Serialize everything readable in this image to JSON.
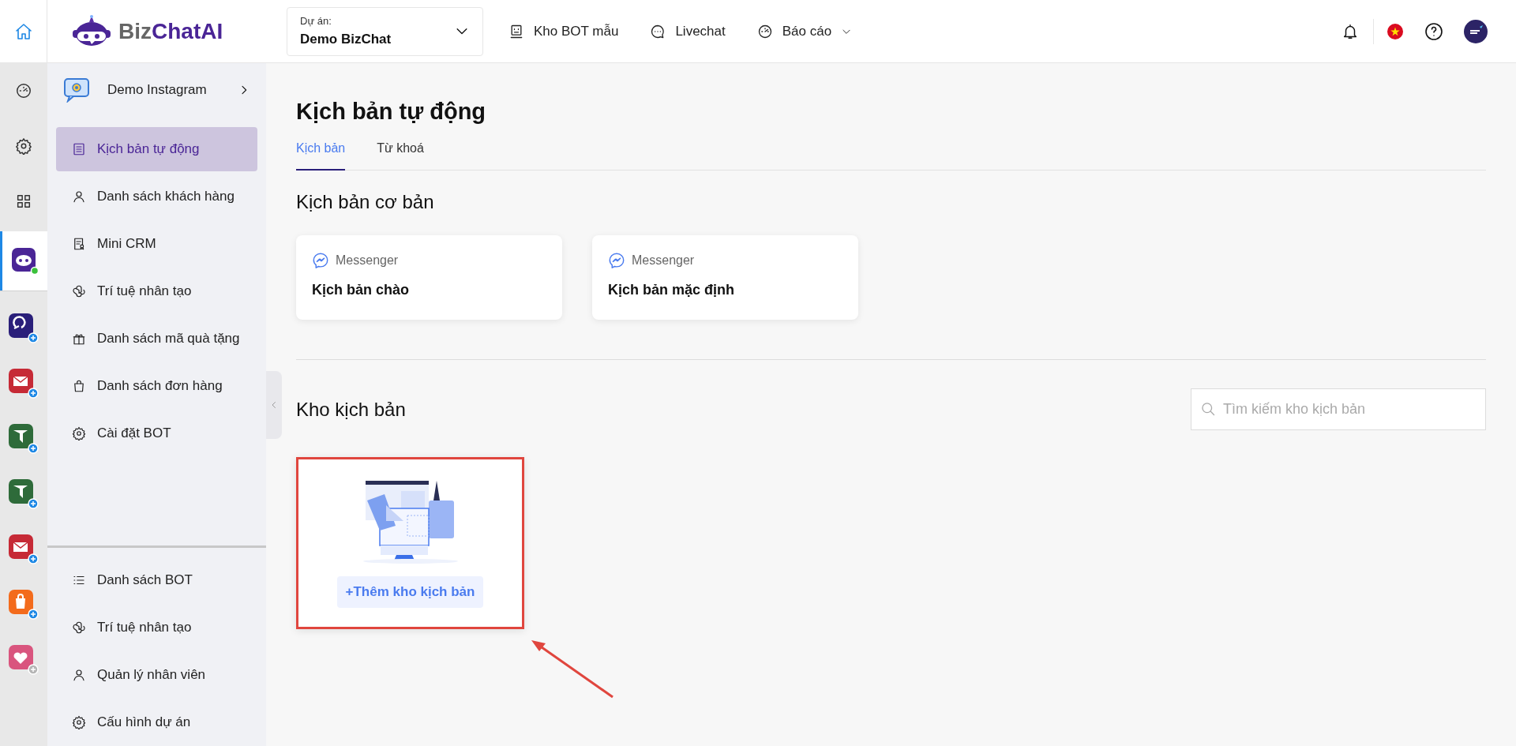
{
  "brand": {
    "name_part_1": "Biz",
    "name_part_2": "ChatAI"
  },
  "project_selector": {
    "label": "Dự án:",
    "value": "Demo BizChat"
  },
  "top_nav": [
    {
      "kind": "bot",
      "label": "Kho BOT mẫu",
      "has_menu": false
    },
    {
      "kind": "chat",
      "label": "Livechat",
      "has_menu": false
    },
    {
      "kind": "report",
      "label": "Báo cáo",
      "has_menu": true
    }
  ],
  "rail": [
    {
      "kind": "dashboard",
      "selected": false
    },
    {
      "kind": "settings",
      "selected": false
    },
    {
      "kind": "grid",
      "selected": false
    },
    {
      "kind": "bot",
      "selected": true
    }
  ],
  "rail_apps": [
    {
      "kind": "swirl",
      "color": "#2a1f7a",
      "badge_enabled": true
    },
    {
      "kind": "mail",
      "color": "#c62a36",
      "badge_enabled": true
    },
    {
      "kind": "plane",
      "color": "#2e6b3a",
      "badge_enabled": true
    },
    {
      "kind": "plane",
      "color": "#2e6b3a",
      "badge_enabled": true
    },
    {
      "kind": "mail",
      "color": "#c62a36",
      "badge_enabled": true
    },
    {
      "kind": "bag",
      "color": "#f36b1c",
      "badge_enabled": true
    },
    {
      "kind": "heart",
      "color": "#d9557e",
      "badge_enabled": false
    }
  ],
  "sidebar": {
    "header": "Demo Instagram",
    "items": [
      {
        "kind": "list",
        "label": "Kịch bản tự động",
        "selected": true
      },
      {
        "kind": "user",
        "label": "Danh sách khách hàng",
        "selected": false
      },
      {
        "kind": "doc",
        "label": "Mini CRM",
        "selected": false
      },
      {
        "kind": "ai",
        "label": "Trí tuệ nhân tạo",
        "selected": false
      },
      {
        "kind": "gift",
        "label": "Danh sách mã quà tặng",
        "selected": false
      },
      {
        "kind": "bag",
        "label": "Danh sách đơn hàng",
        "selected": false
      },
      {
        "kind": "gear",
        "label": "Cài đặt BOT",
        "selected": false
      }
    ],
    "bottom_items": [
      {
        "kind": "lines",
        "label": "Danh sách BOT"
      },
      {
        "kind": "ai",
        "label": "Trí tuệ nhân tạo"
      },
      {
        "kind": "user",
        "label": "Quản lý nhân viên"
      },
      {
        "kind": "gear",
        "label": "Cấu hình dự án"
      }
    ]
  },
  "page": {
    "title": "Kịch bản tự động",
    "tabs": [
      {
        "label": "Kịch bản",
        "selected": true
      },
      {
        "label": "Từ khoá",
        "selected": false
      }
    ],
    "basic_section": {
      "title": "Kịch bản cơ bản",
      "cards": [
        {
          "channel": "Messenger",
          "name": "Kịch bản chào"
        },
        {
          "channel": "Messenger",
          "name": "Kịch bản mặc định"
        }
      ]
    },
    "store_section": {
      "title": "Kho kịch bản",
      "search_placeholder": "Tìm kiếm kho kịch bản",
      "add_button": "+Thêm kho kịch bản"
    }
  }
}
